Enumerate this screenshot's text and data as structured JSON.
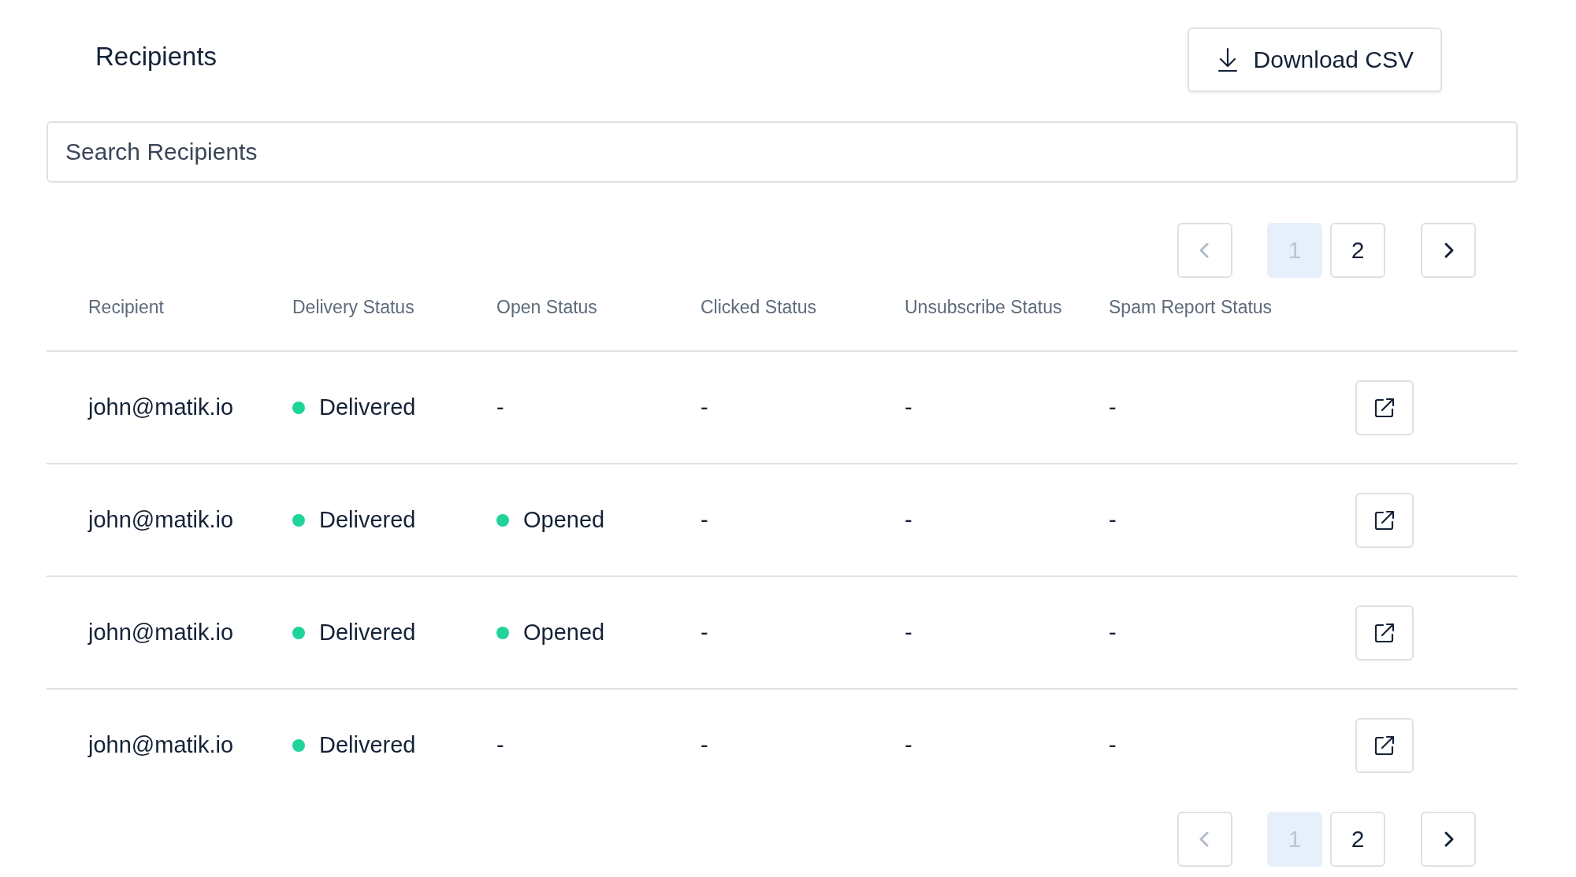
{
  "title": "Recipients",
  "download_button": {
    "label": "Download CSV"
  },
  "search": {
    "placeholder": "Search Recipients"
  },
  "pagination_top": {
    "prev": {
      "disabled": true
    },
    "pages": [
      {
        "label": "1",
        "selected": true
      },
      {
        "label": "2",
        "selected": false
      }
    ],
    "next": {
      "disabled": false
    }
  },
  "table": {
    "columns": [
      "Recipient",
      "Delivery Status",
      "Open Status",
      "Clicked Status",
      "Unsubscribe Status",
      "Spam Report Status"
    ],
    "rows": [
      {
        "cells": [
          {
            "text": "john@matik.io"
          },
          {
            "text": "Delivered",
            "color": "#20d39b"
          },
          {
            "text": "-"
          },
          {
            "text": "-"
          },
          {
            "text": "-"
          },
          {
            "text": "-"
          }
        ]
      },
      {
        "cells": [
          {
            "text": "john@matik.io"
          },
          {
            "text": "Delivered",
            "color": "#20d39b"
          },
          {
            "text": "Opened",
            "color": "#20d39b"
          },
          {
            "text": "-"
          },
          {
            "text": "-"
          },
          {
            "text": "-"
          }
        ]
      },
      {
        "cells": [
          {
            "text": "john@matik.io"
          },
          {
            "text": "Delivered",
            "color": "#20d39b"
          },
          {
            "text": "Opened",
            "color": "#20d39b"
          },
          {
            "text": "-"
          },
          {
            "text": "-"
          },
          {
            "text": "-"
          }
        ]
      },
      {
        "cells": [
          {
            "text": "john@matik.io"
          },
          {
            "text": "Delivered",
            "color": "#20d39b"
          },
          {
            "text": "-"
          },
          {
            "text": "-"
          },
          {
            "text": "-"
          },
          {
            "text": "-"
          }
        ]
      }
    ]
  },
  "pagination_bottom": {
    "prev": {
      "disabled": true
    },
    "pages": [
      {
        "label": "1",
        "selected": true
      },
      {
        "label": "2",
        "selected": false
      }
    ],
    "next": {
      "disabled": false
    }
  }
}
